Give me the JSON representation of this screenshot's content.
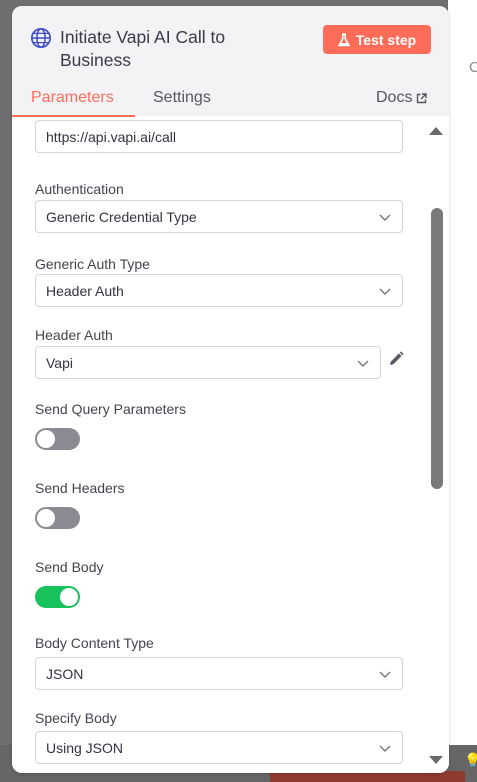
{
  "background": {
    "right_letter": "C"
  },
  "header": {
    "title": "Initiate Vapi AI Call to Business",
    "test_button_label": "Test step",
    "tabs": {
      "parameters": "Parameters",
      "settings": "Settings"
    },
    "docs_label": "Docs"
  },
  "form": {
    "url_value": "https://api.vapi.ai/call",
    "authentication": {
      "label": "Authentication",
      "value": "Generic Credential Type"
    },
    "generic_auth_type": {
      "label": "Generic Auth Type",
      "value": "Header Auth"
    },
    "header_auth": {
      "label": "Header Auth",
      "value": "Vapi"
    },
    "send_query_parameters": {
      "label": "Send Query Parameters",
      "enabled": false
    },
    "send_headers": {
      "label": "Send Headers",
      "enabled": false
    },
    "send_body": {
      "label": "Send Body",
      "enabled": true
    },
    "body_content_type": {
      "label": "Body Content Type",
      "value": "JSON"
    },
    "specify_body": {
      "label": "Specify Body",
      "value": "Using JSON"
    }
  },
  "colors": {
    "accent": "#ff6d5a",
    "toggle_on": "#17c25b",
    "toggle_off": "#8a8a92",
    "globe_icon": "#3f4bc9"
  }
}
